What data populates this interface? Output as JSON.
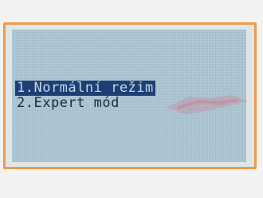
{
  "menu": {
    "items": [
      {
        "label": "1.Normální režim",
        "selected": true
      },
      {
        "label": "2.Expert mód",
        "selected": false
      }
    ]
  },
  "colors": {
    "frame_border": "#ee9a4e",
    "screen_bg": "#9fbcc9",
    "selection_bg": "#1e3f76",
    "text": "#1a2a36"
  }
}
